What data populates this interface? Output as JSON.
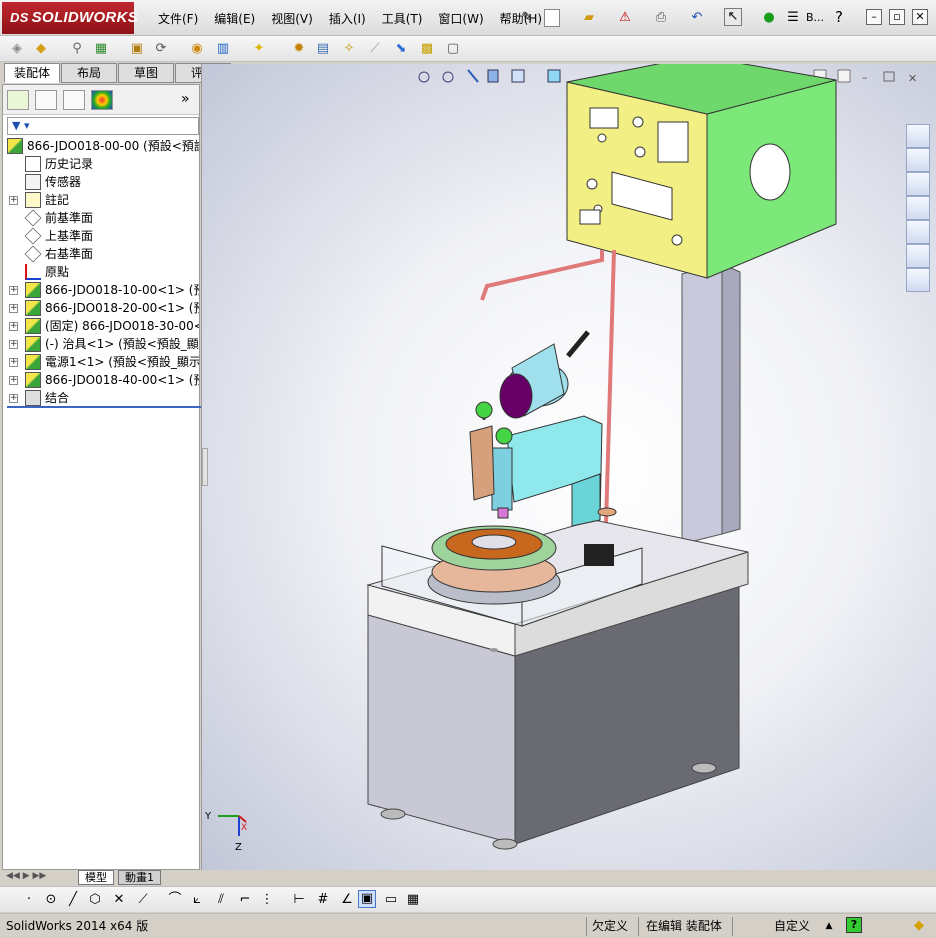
{
  "app": {
    "logo": "SOLIDWORKS",
    "logo_prefix": "DS"
  },
  "menu": [
    "文件(F)",
    "编辑(E)",
    "视图(V)",
    "插入(I)",
    "工具(T)",
    "窗口(W)",
    "帮助(H)"
  ],
  "title_extra": "B...",
  "tabs": [
    "装配体",
    "布局",
    "草图",
    "评估"
  ],
  "active_tab": "装配体",
  "panel_more": "»",
  "tree": [
    {
      "label": "866-JDO018-00-00  (預設<預設_顯",
      "icon": "assembly-icon",
      "indent": 0,
      "expander": ""
    },
    {
      "label": "历史记录",
      "icon": "history-icon",
      "indent": 1,
      "expander": ""
    },
    {
      "label": "传感器",
      "icon": "sensor-icon",
      "indent": 1,
      "expander": ""
    },
    {
      "label": "註記",
      "icon": "annotation-icon",
      "indent": 1,
      "expander": "+"
    },
    {
      "label": "前基準面",
      "icon": "plane-icon",
      "indent": 1,
      "expander": ""
    },
    {
      "label": "上基準面",
      "icon": "plane-icon",
      "indent": 1,
      "expander": ""
    },
    {
      "label": "右基準面",
      "icon": "plane-icon",
      "indent": 1,
      "expander": ""
    },
    {
      "label": "原點",
      "icon": "origin-icon",
      "indent": 1,
      "expander": ""
    },
    {
      "label": "866-JDO018-10-00<1> (預設<預",
      "icon": "subassembly-icon",
      "indent": 1,
      "expander": "+"
    },
    {
      "label": "866-JDO018-20-00<1> (預設<預",
      "icon": "subassembly-icon",
      "indent": 1,
      "expander": "+"
    },
    {
      "label": "(固定) 866-JDO018-30-00<1> (",
      "icon": "subassembly-icon",
      "indent": 1,
      "expander": "+"
    },
    {
      "label": "(-) 治具<1> (預設<預設_顯示",
      "icon": "subassembly-icon",
      "indent": 1,
      "expander": "+"
    },
    {
      "label": "電源1<1> (預設<預設_顯示狀",
      "icon": "subassembly-icon",
      "indent": 1,
      "expander": "+"
    },
    {
      "label": "866-JDO018-40-00<1> (預設<",
      "icon": "subassembly-icon",
      "indent": 1,
      "expander": "+"
    },
    {
      "label": "结合",
      "icon": "mates-icon",
      "indent": 1,
      "expander": "+"
    }
  ],
  "bottom_tabs": [
    "模型",
    "動畫1"
  ],
  "triad": {
    "y": "Y",
    "x": "X",
    "z": "Z"
  },
  "status": {
    "app_version": "SolidWorks 2014 x64 版",
    "state": "欠定义",
    "mode": "在编辑 装配体",
    "units": "自定义",
    "help": "?"
  },
  "colors": {
    "accent": "#3b66c2",
    "logo_red": "#b01c23",
    "box_green": "#7de87a",
    "box_yellow": "#f2ef84",
    "cyan": "#8fe9ec"
  }
}
